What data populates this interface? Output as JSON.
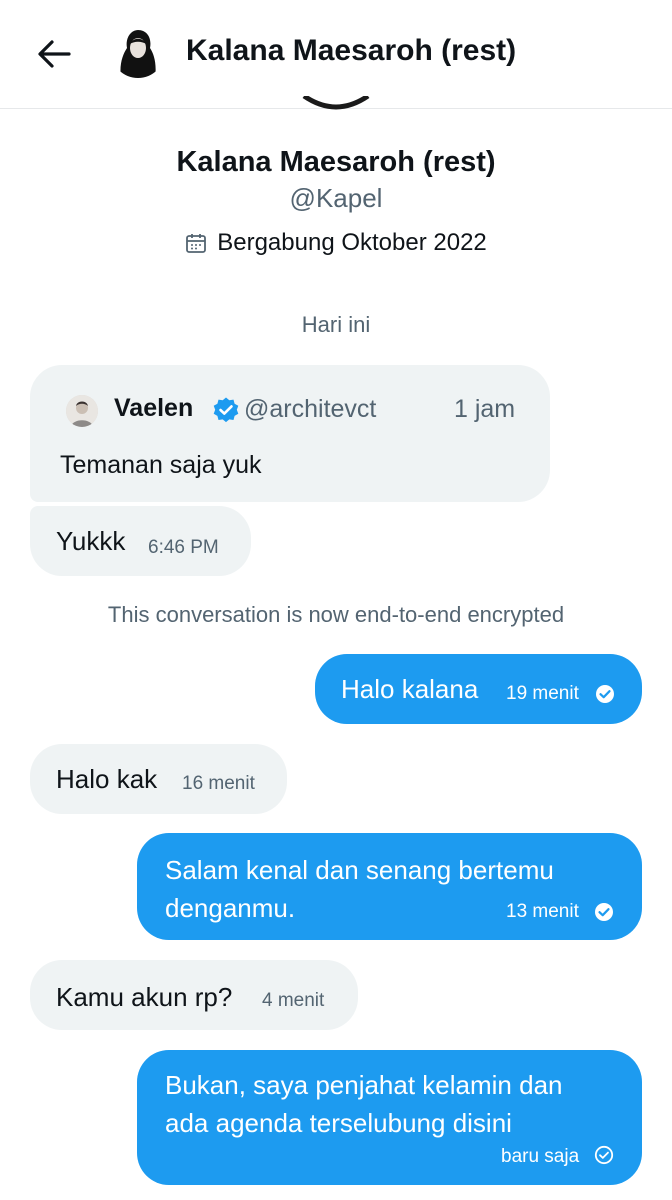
{
  "header": {
    "title": "Kalana Maesaroh (rest)"
  },
  "profile": {
    "name": "Kalana Maesaroh (rest)",
    "handle": "@Kapel",
    "joined": "Bergabung Oktober 2022"
  },
  "conversation": {
    "day_label": "Hari ini",
    "quoted_post": {
      "author": "Vaelen",
      "handle": "@architevct",
      "time": "1 jam",
      "text": "Temanan saja yuk"
    },
    "encryption_notice": "This conversation is now end-to-end encrypted",
    "messages": [
      {
        "direction": "in",
        "text": "Yukkk",
        "time": "6:46 PM"
      },
      {
        "direction": "out",
        "text": "Halo kalana",
        "time": "19 menit"
      },
      {
        "direction": "in",
        "text": "Halo kak",
        "time": "16 menit"
      },
      {
        "direction": "out",
        "lines": [
          "Salam kenal dan senang bertemu",
          "denganmu."
        ],
        "time": "13 menit"
      },
      {
        "direction": "in",
        "text": "Kamu akun rp?",
        "time": "4 menit"
      },
      {
        "direction": "out",
        "lines": [
          "Bukan, saya penjahat kelamin dan",
          "ada agenda terselubung disini"
        ],
        "time": "baru saja"
      }
    ]
  },
  "colors": {
    "accent": "#1d9bf0",
    "incoming_bg": "#eff3f4",
    "muted_text": "#536471",
    "verified": "#1d9bf0"
  }
}
